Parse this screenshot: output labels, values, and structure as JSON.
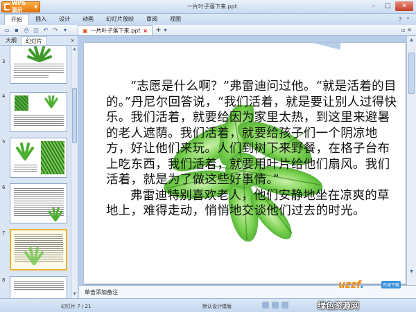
{
  "app": {
    "name": "WPS 演示",
    "window_title": "一片叶子落下来.ppt"
  },
  "ribbon": {
    "tabs": [
      "开始",
      "插入",
      "设计",
      "动画",
      "幻灯片放映",
      "审阅",
      "视图"
    ]
  },
  "document_tab": {
    "label": "一片叶子落下来.ppt"
  },
  "left_panel": {
    "tabs": [
      "大纲",
      "幻灯片"
    ],
    "close": "×",
    "slides": [
      {
        "num": "3"
      },
      {
        "num": "4"
      },
      {
        "num": "5"
      },
      {
        "num": "6"
      },
      {
        "num": "7"
      },
      {
        "num": "8"
      }
    ]
  },
  "slide": {
    "paragraphs": [
      "“志愿是什么啊？”弗雷迪问过他。“就是活着的目的。”丹尼尔回答说，“我们活着，就是要让别人过得快乐。我们活着，就要给因为家里太热，到这里来避暑的老人遮荫。我们活着，就要给孩子们一个阴凉地方，好让他们来玩。人们到树下来野餐，在格子台布上吃东西，我们活着，就要用叶片给他们扇风。我们活着，就是为了做这些好事情。”",
      "弗雷迪特别喜欢老人，他们安静地坐在凉爽的草地上，难得走动，悄悄地交谈他们过去的时光。"
    ]
  },
  "notes": {
    "placeholder": "单击添加备注"
  },
  "status": {
    "page": "幻灯片 7 / 21",
    "template": "默认设计模版"
  },
  "watermark": {
    "logo": "uzzf",
    "badge": "东坡下载",
    "text": "绿色资源网"
  },
  "colors": {
    "app_orange": "#e8760d",
    "leaf_green": "#5fbf3a",
    "selection": "#f0b030"
  }
}
